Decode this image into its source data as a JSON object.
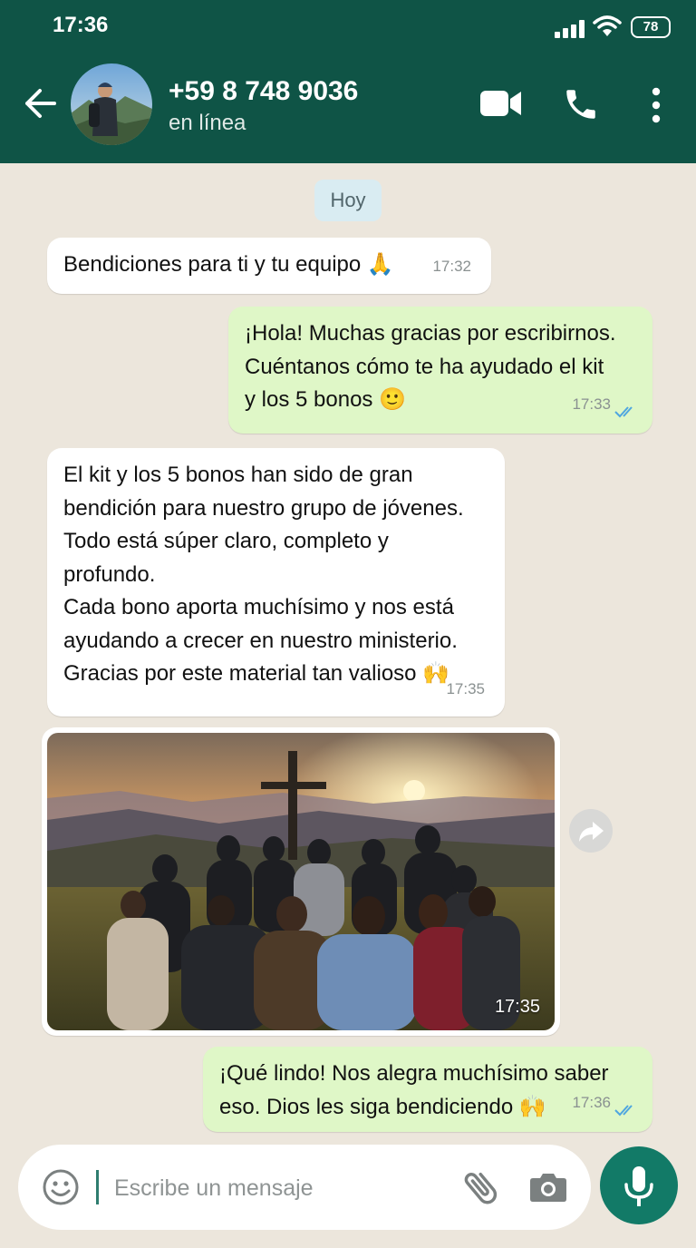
{
  "status_bar": {
    "time": "17:36",
    "battery": "78"
  },
  "header": {
    "contact_name": "+59 8 748 9036",
    "contact_status": "en línea"
  },
  "chat": {
    "date_separator": "Hoy",
    "messages": [
      {
        "direction": "incoming",
        "lines": [
          "Bendiciones para ti y tu equipo 🙏"
        ],
        "time": "17:32"
      },
      {
        "direction": "outgoing",
        "lines": [
          "¡Hola! Muchas gracias por escribirnos.",
          "Cuéntanos cómo te ha ayudado el kit",
          "y los 5 bonos 🙂"
        ],
        "time": "17:33",
        "read": true
      },
      {
        "direction": "incoming",
        "lines": [
          "El kit y los 5 bonos han sido de gran",
          "bendición para nuestro grupo de jóvenes.",
          "Todo está súper claro, completo y",
          "profundo.",
          "Cada bono aporta muchísimo y nos está",
          "ayudando a crecer en nuestro ministerio.",
          "Gracias por este material tan valioso 🙌"
        ],
        "time": "17:35"
      },
      {
        "direction": "incoming",
        "type": "image",
        "time": "17:35"
      },
      {
        "direction": "outgoing",
        "lines": [
          "¡Qué lindo! Nos alegra muchísimo saber",
          "eso. Dios les siga bendiciendo 🙌"
        ],
        "time": "17:36",
        "read": true
      }
    ]
  },
  "composer": {
    "placeholder": "Escribe un mensaje",
    "value": ""
  },
  "icons": {
    "back": "arrow-left-icon",
    "video": "video-camera-icon",
    "call": "phone-icon",
    "menu": "more-vertical-icon",
    "emoji": "emoji-icon",
    "attach": "paperclip-icon",
    "camera": "camera-icon",
    "mic": "microphone-icon",
    "forward": "forward-icon"
  },
  "colors": {
    "header": "#0f5446",
    "outgoing_bubble": "#dff7c7",
    "incoming_bubble": "#ffffff",
    "chat_bg": "#ece6dc",
    "read_ticks": "#4fa6e0",
    "mic_button": "#127a67"
  }
}
